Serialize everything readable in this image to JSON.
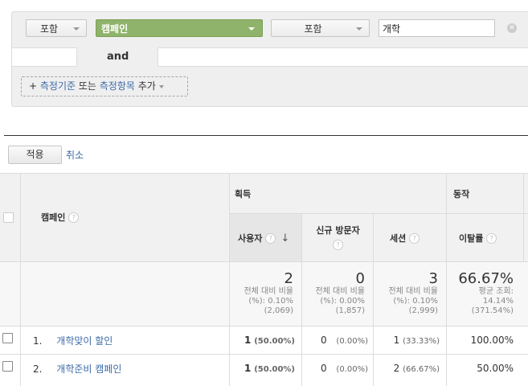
{
  "filter": {
    "include_label_1": "포함",
    "dimension_label": "캠페인",
    "include_label_2": "포함",
    "search_value": "개학",
    "and_label": "and",
    "add_prefix": "+ ",
    "add_dimension": "측정기준",
    "add_or": " 또는 ",
    "add_metric": "측정항목",
    "add_suffix": " 추가"
  },
  "actions": {
    "apply_label": "적용",
    "cancel_label": "취소"
  },
  "table": {
    "group_acquisition": "획득",
    "group_behavior": "동작",
    "col_campaign": "캠페인",
    "col_users": "사용자",
    "col_new_users": "신규 방문자",
    "col_sessions": "세션",
    "col_bounce": "이탈률",
    "totals": {
      "users": "2",
      "users_sub1": "전체 대비 비율",
      "users_sub2": "(%): 0.10%",
      "users_sub3": "(2,069)",
      "new_users": "0",
      "new_users_sub1": "전체 대비 비율",
      "new_users_sub2": "(%): 0.00%",
      "new_users_sub3": "(1,857)",
      "sessions": "3",
      "sessions_sub1": "전체 대비 비율",
      "sessions_sub2": "(%): 0.10%",
      "sessions_sub3": "(2,999)",
      "bounce": "66.67%",
      "bounce_sub1": "평균 조회:",
      "bounce_sub2": "14.14%",
      "bounce_sub3": "(371.54%)"
    },
    "rows": [
      {
        "index": "1.",
        "name": "개학맞이 할인",
        "users": "1",
        "users_pct": "(50.00%)",
        "new_users": "0",
        "new_users_pct": "(0.00%)",
        "sessions": "1",
        "sessions_pct": "(33.33%)",
        "bounce": "100.00%"
      },
      {
        "index": "2.",
        "name": "개학준비 캠페인",
        "users": "1",
        "users_pct": "(50.00%)",
        "new_users": "0",
        "new_users_pct": "(0.00%)",
        "sessions": "2",
        "sessions_pct": "(66.67%)",
        "bounce": "50.00%"
      }
    ]
  }
}
